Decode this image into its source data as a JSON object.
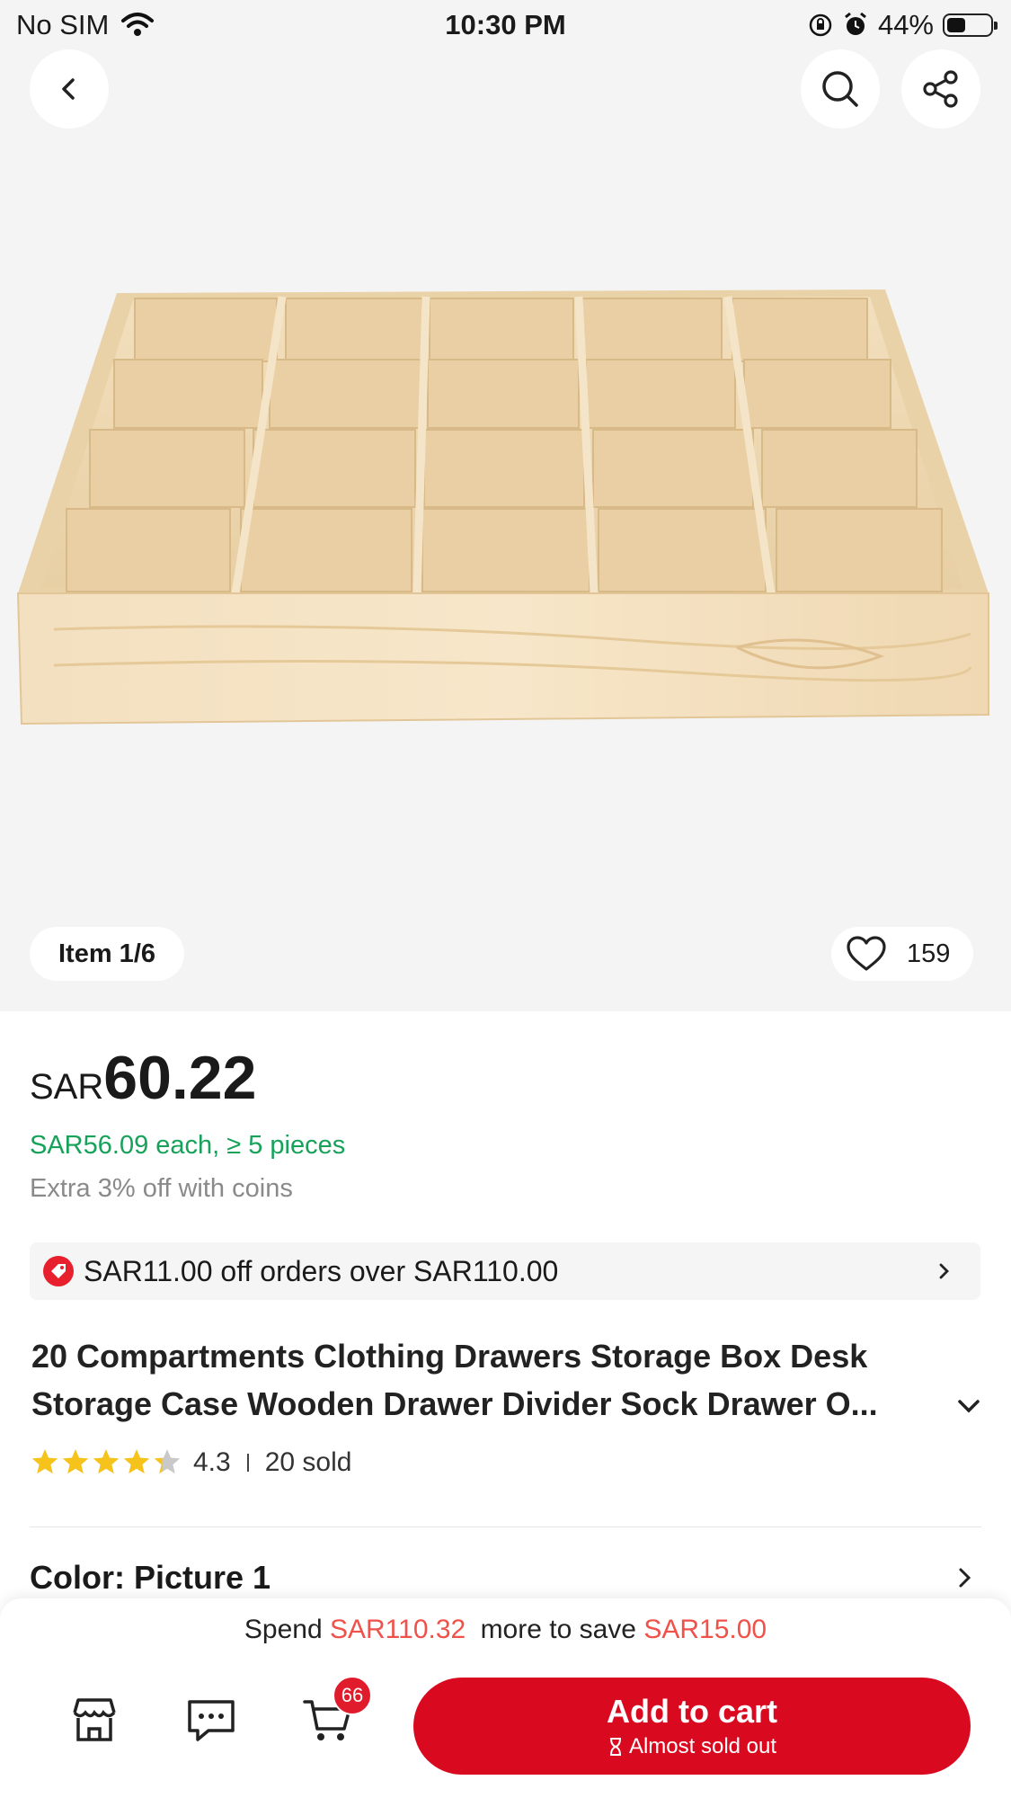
{
  "status_bar": {
    "carrier": "No SIM",
    "time": "10:30 PM",
    "battery": "44%",
    "battery_level": 0.44
  },
  "gallery": {
    "counter": "Item 1/6",
    "likes": "159"
  },
  "price": {
    "currency": "SAR",
    "value": "60.22"
  },
  "bulk_price": "SAR56.09 each, ≥ 5 pieces",
  "coins_note": "Extra 3% off with coins",
  "coupon": {
    "text": "SAR11.00 off orders over SAR110.00"
  },
  "product": {
    "title_line1": "20 Compartments Clothing Drawers Storage Box Desk",
    "title_line2": "Storage Case Wooden Drawer Divider Sock Drawer O..."
  },
  "rating": {
    "value": "4.3",
    "stars": 4.3,
    "sold": "20 sold"
  },
  "color_option": {
    "label": "Color: Picture 1"
  },
  "bottom_bar": {
    "spend_prefix": "Spend",
    "spend_amount": "SAR110.32",
    "spend_middle": "more to save",
    "save_amount": "SAR15.00",
    "cart_count": "66",
    "add_to_cart": "Add to cart",
    "stock_note": "Almost sold out"
  },
  "colors": {
    "accent": "#d90a1f",
    "green": "#17a25a",
    "star": "#f6c21c"
  }
}
